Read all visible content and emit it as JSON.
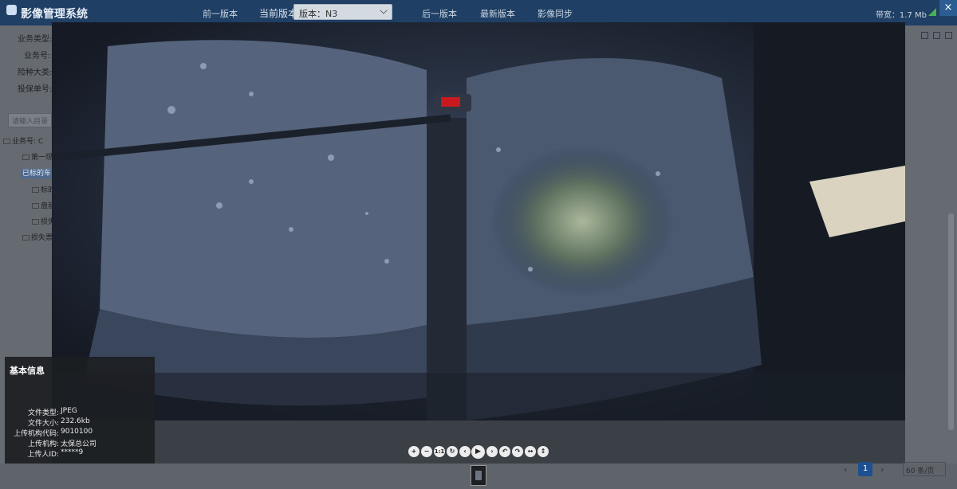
{
  "app": {
    "title": "影像管理系统"
  },
  "topbar": {
    "prev_version": "前一版本",
    "current_version_label": "当前版本",
    "version_select_value": "版本：N3",
    "next_version": "后一版本",
    "latest_version": "最新版本",
    "sync": "影像同步",
    "bandwidth": "带宽：1.7 Mb",
    "close_label": "×"
  },
  "left_panel": {
    "fields": [
      "业务类型:",
      "业务号:",
      "险种大类:",
      "投保单号:"
    ],
    "search_placeholder": "请输入目录",
    "tree": [
      "业务号: C",
      "第一现",
      "已标的车",
      "标的",
      "盘前",
      "损失",
      "损失票"
    ]
  },
  "viewer": {
    "image_description_icon": "car-seat-photo",
    "toolbar": [
      {
        "name": "zoom-in-button",
        "glyph": "+"
      },
      {
        "name": "zoom-out-button",
        "glyph": "−"
      },
      {
        "name": "actual-size-button",
        "glyph": "1:1"
      },
      {
        "name": "reset-button",
        "glyph": "↻"
      },
      {
        "name": "prev-image-button",
        "glyph": "‹"
      },
      {
        "name": "play-button",
        "glyph": "▶"
      },
      {
        "name": "next-image-button",
        "glyph": "›"
      },
      {
        "name": "rotate-left-button",
        "glyph": "↶"
      },
      {
        "name": "rotate-right-button",
        "glyph": "↷"
      },
      {
        "name": "flip-horizontal-button",
        "glyph": "↔"
      },
      {
        "name": "flip-vertical-button",
        "glyph": "↕"
      }
    ]
  },
  "info": {
    "title": "基本信息",
    "rows": [
      {
        "key": "文件类型:",
        "value": "JPEG"
      },
      {
        "key": "文件大小:",
        "value": "232.6kb"
      },
      {
        "key": "上传机构代码:",
        "value": "9010100"
      },
      {
        "key": "上传机构:",
        "value": "太保总公司"
      },
      {
        "key": "上传人ID:",
        "value": "*****9"
      }
    ]
  },
  "pager": {
    "prev": "‹",
    "current_page": "1",
    "next": "›",
    "page_size": "60 条/页"
  },
  "colors": {
    "accent": "#1e4f8f",
    "topbar": "#1f3f64"
  }
}
